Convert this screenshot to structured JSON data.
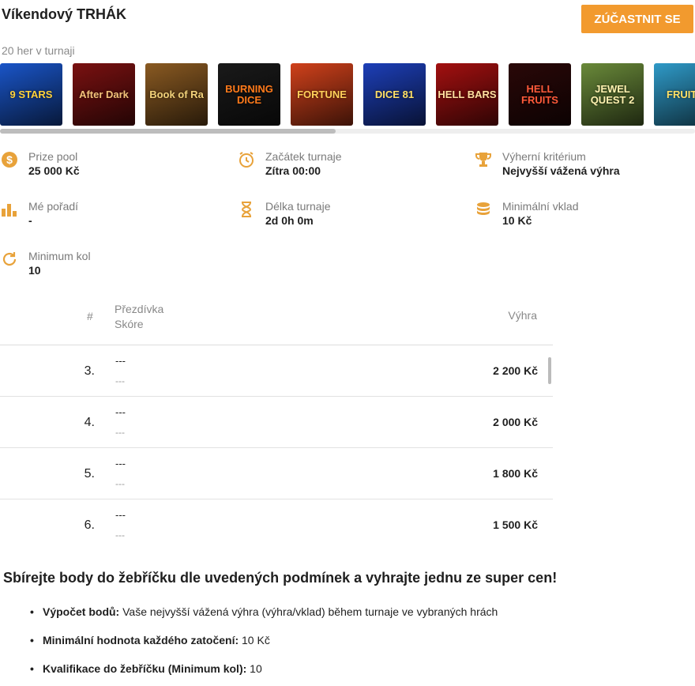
{
  "header": {
    "title": "Víkendový TRHÁK",
    "join_label": "ZÚČASTNIT SE",
    "games_count": "20 her v turnaji"
  },
  "games": [
    {
      "name": "9 STARS",
      "bg": "#1a55c8",
      "fg": "#ffd23a"
    },
    {
      "name": "After Dark",
      "bg": "#7a1111",
      "fg": "#f3c27a"
    },
    {
      "name": "Book of Ra",
      "bg": "#8a5a22",
      "fg": "#f2d27a"
    },
    {
      "name": "BURNING DICE",
      "bg": "#1a1a1a",
      "fg": "#ff7a1a"
    },
    {
      "name": "FORTUNE",
      "bg": "#d0411b",
      "fg": "#ffd05a"
    },
    {
      "name": "DICE 81",
      "bg": "#1d3fb8",
      "fg": "#ffe066"
    },
    {
      "name": "HELL BARS",
      "bg": "#a31010",
      "fg": "#ffe0a0"
    },
    {
      "name": "HELL FRUITS",
      "bg": "#2a0808",
      "fg": "#ff5a3a"
    },
    {
      "name": "JEWEL QUEST 2",
      "bg": "#6a8a3a",
      "fg": "#fff2b0"
    },
    {
      "name": "FRUITS",
      "bg": "#2f9ac8",
      "fg": "#ffe066"
    }
  ],
  "info": {
    "prize_pool": {
      "label": "Prize pool",
      "value": "25 000 Kč"
    },
    "start": {
      "label": "Začátek turnaje",
      "value": "Zítra 00:00"
    },
    "criterion": {
      "label": "Výherní kritérium",
      "value": "Nejvyšší vážená výhra"
    },
    "my_rank": {
      "label": "Mé pořadí",
      "value": "-"
    },
    "duration": {
      "label": "Délka turnaje",
      "value": "2d 0h 0m"
    },
    "min_deposit": {
      "label": "Minimální vklad",
      "value": "10 Kč"
    },
    "min_rounds": {
      "label": "Minimum kol",
      "value": "10"
    }
  },
  "table": {
    "col_num": "#",
    "col_nick": "Přezdívka",
    "col_score": "Skóre",
    "col_prize": "Výhra",
    "rows": [
      {
        "rank": "3.",
        "nick": "---",
        "score": "---",
        "prize": "2 200 Kč"
      },
      {
        "rank": "4.",
        "nick": "---",
        "score": "---",
        "prize": "2 000 Kč"
      },
      {
        "rank": "5.",
        "nick": "---",
        "score": "---",
        "prize": "1 800 Kč"
      },
      {
        "rank": "6.",
        "nick": "---",
        "score": "---",
        "prize": "1 500 Kč"
      }
    ]
  },
  "description": {
    "title": "Sbírejte body do žebříčku dle uvedených podmínek a vyhrajte jednu ze super cen!",
    "rules": [
      {
        "key": "Výpočet bodů:",
        "text": " Vaše nejvyšší vážená výhra (výhra/vklad) během turnaje ve vybraných hrách"
      },
      {
        "key": "Minimální hodnota každého zatočení:",
        "text": " 10 Kč"
      },
      {
        "key": "Kvalifikace do žebříčku (Minimum kol):",
        "text": " 10"
      }
    ]
  },
  "colors": {
    "accent": "#f29a2e",
    "icon": "#e8a23a"
  }
}
